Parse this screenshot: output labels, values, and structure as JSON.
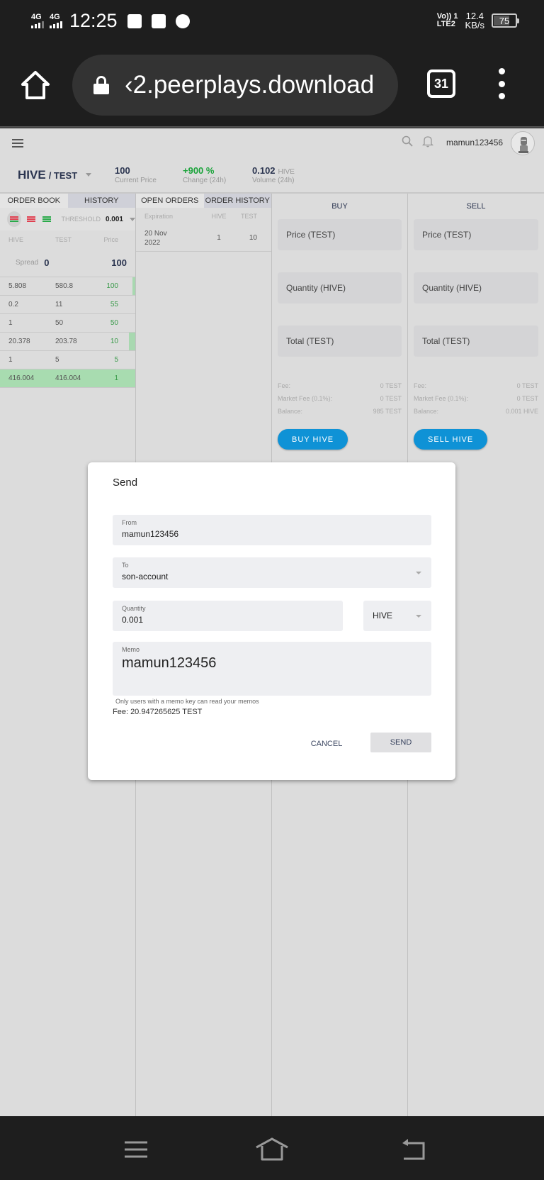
{
  "status_bar": {
    "sim1": "4G",
    "sim2": "4G",
    "time": "12:25",
    "network_line1": "Vo)) 1",
    "network_line2": "LTE2",
    "speed_value": "12.4",
    "speed_unit": "KB/s",
    "battery": "75",
    "battery_level_pct": 75,
    "icons": [
      "mail-icon",
      "shopping-bag-icon",
      "speedometer-icon"
    ]
  },
  "browser": {
    "url": "‹2.peerplays.download",
    "tab_count": "31",
    "icons": [
      "home-icon",
      "lock-icon",
      "tabs-icon",
      "menu-kebab-icon"
    ]
  },
  "topnav": {
    "username": "mamun123456",
    "icons": [
      "hamburger-icon",
      "search-icon",
      "bell-icon",
      "avatar"
    ]
  },
  "market": {
    "base": "HIVE",
    "quote": "/ TEST",
    "current_price": "100",
    "current_price_label": "Current Price",
    "change": "+900 %",
    "change_label": "Change (24h)",
    "volume": "0.102",
    "volume_unit": "HIVE",
    "volume_label": "Volume (24h)"
  },
  "orderbook": {
    "tabs": [
      "ORDER BOOK",
      "HISTORY"
    ],
    "threshold_label": "THRESHOLD",
    "threshold_value": "0.001",
    "columns": [
      "HIVE",
      "TEST",
      "Price"
    ],
    "spread_label": "Spread",
    "spread_value": "0",
    "spread_price": "100",
    "rows": [
      {
        "hive": "5.808",
        "test": "580.8",
        "price": "100",
        "depth": 0.02
      },
      {
        "hive": "0.2",
        "test": "11",
        "price": "55",
        "depth": 0
      },
      {
        "hive": "1",
        "test": "50",
        "price": "50",
        "depth": 0
      },
      {
        "hive": "20.378",
        "test": "203.78",
        "price": "10",
        "depth": 0.05
      },
      {
        "hive": "1",
        "test": "5",
        "price": "5",
        "depth": 0
      },
      {
        "hive": "416.004",
        "test": "416.004",
        "price": "1",
        "depth": 1
      }
    ]
  },
  "orders": {
    "tabs": [
      "OPEN ORDERS",
      "ORDER HISTORY"
    ],
    "columns": [
      "Expiration",
      "HIVE",
      "TEST"
    ],
    "rows": [
      {
        "expiration_line1": "20 Nov",
        "expiration_line2": "2022",
        "hive": "1",
        "test": "10"
      }
    ]
  },
  "buy": {
    "title": "BUY",
    "price_placeholder": "Price (TEST)",
    "quantity_placeholder": "Quantity (HIVE)",
    "total_placeholder": "Total (TEST)",
    "fee_label": "Fee:",
    "fee_value": "0 TEST",
    "market_fee_label": "Market Fee (0.1%):",
    "market_fee_value": "0 TEST",
    "balance_label": "Balance:",
    "balance_value": "985 TEST",
    "button": "BUY HIVE"
  },
  "sell": {
    "title": "SELL",
    "price_placeholder": "Price (TEST)",
    "quantity_placeholder": "Quantity (HIVE)",
    "total_placeholder": "Total (TEST)",
    "fee_label": "Fee:",
    "fee_value": "0 TEST",
    "market_fee_label": "Market Fee (0.1%):",
    "market_fee_value": "0 TEST",
    "balance_label": "Balance:",
    "balance_value": "0.001 HIVE",
    "button": "SELL HIVE"
  },
  "send_dialog": {
    "title": "Send",
    "from_label": "From",
    "from_value": "mamun123456",
    "to_label": "To",
    "to_value": "son-account",
    "quantity_label": "Quantity",
    "quantity_value": "0.001",
    "asset_value": "HIVE",
    "memo_label": "Memo",
    "memo_value": "mamun123456",
    "memo_hint": "Only users with a memo key can read your memos",
    "fee": "Fee: 20.947265625 TEST",
    "cancel": "CANCEL",
    "send": "SEND"
  },
  "colors": {
    "accent_blue": "#0f92d6",
    "positive_green": "#1aa33a",
    "text_navy": "#2b3550",
    "ask_red": "#e04050",
    "bid_green": "#2aaa4a"
  },
  "android_nav": {
    "icons": [
      "recents-icon",
      "home-icon",
      "back-icon"
    ]
  }
}
